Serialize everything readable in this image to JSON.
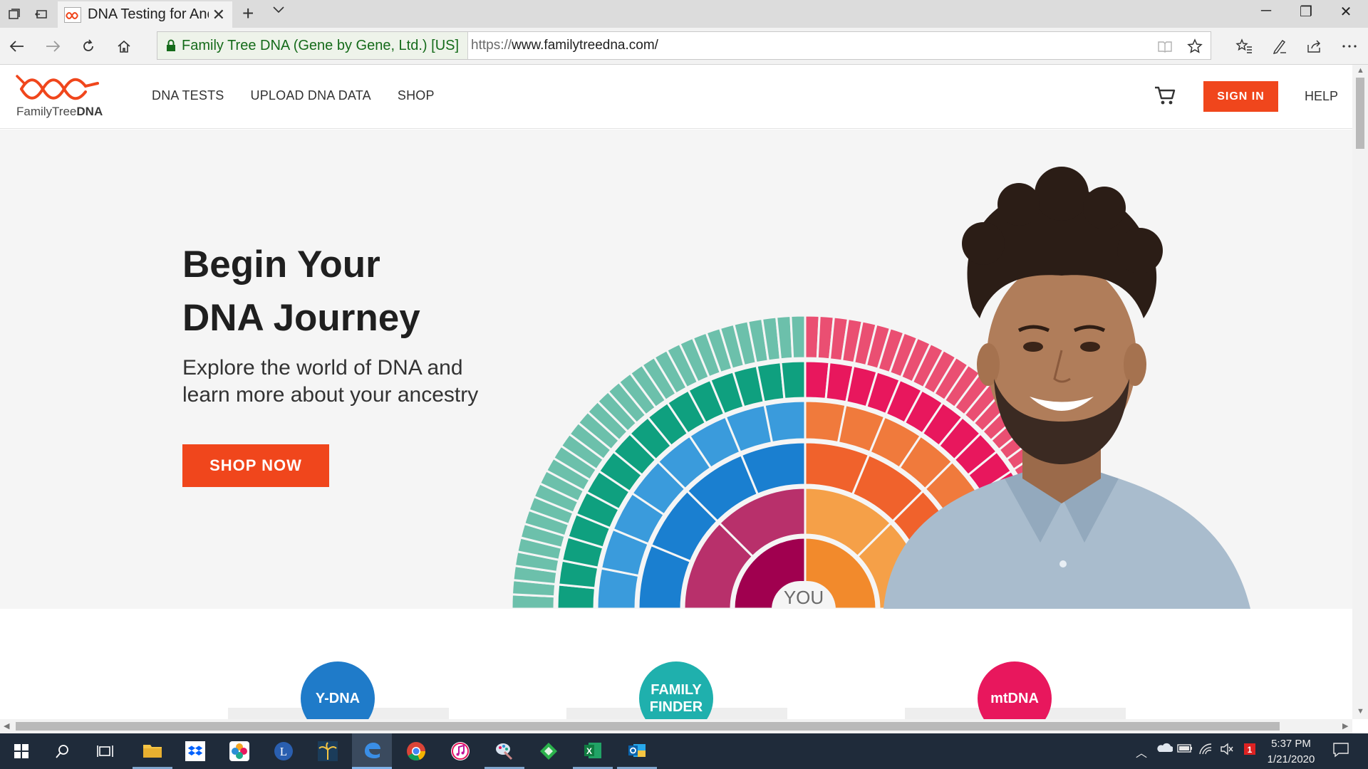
{
  "browser": {
    "tab_title": "DNA Testing for Anc",
    "certificate": "Family Tree DNA (Gene by Gene, Ltd.) [US]",
    "url_protocol": "https://",
    "url_rest": "www.familytreedna.com/"
  },
  "site": {
    "logo_text_light": "FamilyTree",
    "logo_text_bold": "DNA",
    "nav": [
      "DNA TESTS",
      "UPLOAD DNA DATA",
      "SHOP"
    ],
    "sign_in": "SIGN IN",
    "help": "HELP"
  },
  "hero": {
    "title_line1": "Begin Your",
    "title_line2": "DNA Journey",
    "subtitle_line1": "Explore the world of DNA and",
    "subtitle_line2": "learn more about your ancestry",
    "cta": "SHOP NOW",
    "you_label": "YOU"
  },
  "products": [
    {
      "label": "Y-DNA",
      "color": "#1f7bc9"
    },
    {
      "label_line1": "FAMILY",
      "label_line2": "FINDER",
      "color": "#1fb0ad"
    },
    {
      "label": "mtDNA",
      "color": "#e8175d"
    }
  ],
  "colors": {
    "accent": "#f0461c",
    "teal": "#1fa98b",
    "blue": "#2c8fd6",
    "magenta": "#b8306b",
    "red": "#e8175d",
    "orange": "#f28a2c"
  },
  "taskbar": {
    "time": "5:37 PM",
    "date": "1/21/2020",
    "apps": [
      "start-icon",
      "search-icon",
      "task-view-icon",
      "file-explorer-icon",
      "dropbox-icon",
      "photos-icon",
      "l-app-icon",
      "palm-app-icon",
      "edge-icon",
      "chrome-icon",
      "itunes-icon",
      "paint-icon",
      "feedly-icon",
      "excel-icon",
      "outlook-icon"
    ]
  }
}
